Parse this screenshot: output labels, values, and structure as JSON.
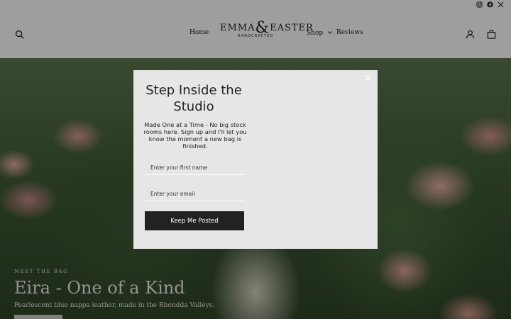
{
  "header": {
    "social": [
      "instagram-icon",
      "facebook-icon",
      "x-icon"
    ],
    "nav": [
      {
        "label": "Home"
      },
      {
        "label": "Shop"
      },
      {
        "label": "Reviews"
      }
    ],
    "logo": {
      "left": "EMMA",
      "amp": "&",
      "right": "EASTER",
      "sub": "HANDCRAFTED"
    }
  },
  "hero": {
    "kicker": "MEET THE BAG",
    "title": "Eira - One of a Kind",
    "subtitle": "Pearlescent blue nappa leather, made in the Rhondda Valleys."
  },
  "modal": {
    "title": "Step Inside the Studio",
    "text": "Made One at a Time - No big stock rooms here. Sign up and I'll let you know the moment a new bag is finished.",
    "first_name_placeholder": "Enter your first name",
    "email_placeholder": "Enter your email",
    "submit_label": "Keep Me Posted",
    "close_glyph": "×"
  }
}
